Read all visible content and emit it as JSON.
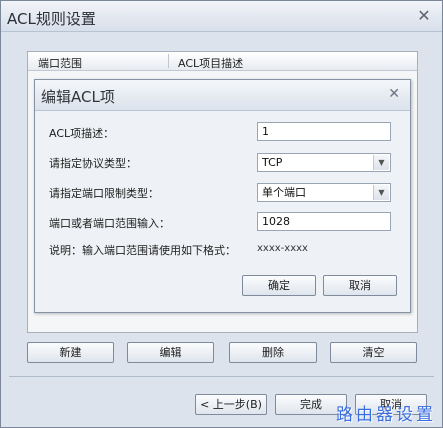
{
  "window": {
    "title": "ACL规则设置",
    "close_glyph": "✕"
  },
  "table": {
    "columns": [
      "端口范围",
      "ACL项目描述"
    ]
  },
  "dialog": {
    "title": "编辑ACL项",
    "close_glyph": "✕",
    "fields": [
      {
        "label": "ACL项描述：",
        "value": "1"
      },
      {
        "label": "请指定协议类型：",
        "value": "TCP"
      },
      {
        "label": "请指定端口限制类型：",
        "value": "单个端口"
      },
      {
        "label": "端口或者端口范围输入：",
        "value": "1028"
      }
    ],
    "hint_label": "说明：输入端口范围请使用如下格式：",
    "hint_format": "xxxx-xxxx",
    "ok_label": "确定",
    "cancel_label": "取消"
  },
  "actions": {
    "new_label": "新建",
    "edit_label": "编辑",
    "delete_label": "删除",
    "clear_label": "清空"
  },
  "footer": {
    "back_label": "< 上一步(B)",
    "finish_label": "完成",
    "cancel_label": "取消"
  },
  "watermark": "路由器设置",
  "colors": {
    "watermark": "#3a6de0",
    "dialog_bg": "#e7ebf1"
  },
  "icons": {
    "close": "close-icon",
    "dropdown": "chevron-down-icon"
  }
}
